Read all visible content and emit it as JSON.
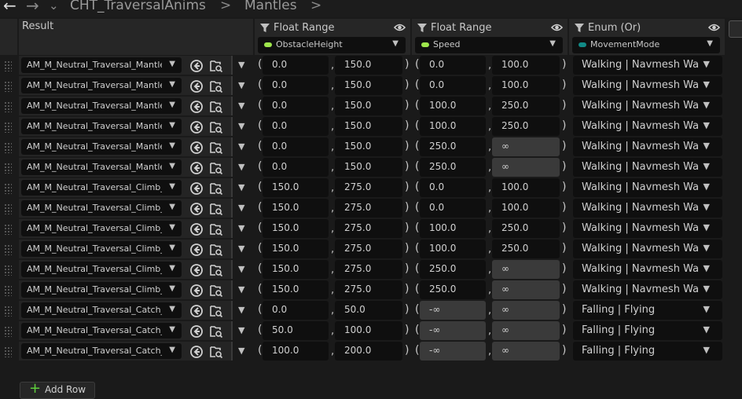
{
  "nav": {
    "back_icon": "arrow-left-icon",
    "forward_icon": "arrow-right-icon",
    "history_icon": "chevron-down-icon",
    "breadcrumb": [
      "CHT_TraversalAnims",
      "Mantles"
    ],
    "separator": ">"
  },
  "columns": {
    "result": {
      "title": "Result"
    },
    "filters": [
      {
        "title": "Float Range",
        "value": "ObstacleHeight",
        "pill_color": "#9ee64c"
      },
      {
        "title": "Float Range",
        "value": "Speed",
        "pill_color": "#9ee64c"
      },
      {
        "title": "Enum (Or)",
        "value": "MovementMode",
        "pill_color": "#118a86"
      }
    ]
  },
  "rows": [
    {
      "asset": "AM_M_Neutral_Traversal_Mantle_",
      "h_min": "0.0",
      "h_max": "150.0",
      "s_min": "0.0",
      "s_max": "100.0",
      "mode": "Walking | Navmesh Walking"
    },
    {
      "asset": "AM_M_Neutral_Traversal_Mantle_",
      "h_min": "0.0",
      "h_max": "150.0",
      "s_min": "0.0",
      "s_max": "100.0",
      "mode": "Walking | Navmesh Walking"
    },
    {
      "asset": "AM_M_Neutral_Traversal_Mantle_",
      "h_min": "0.0",
      "h_max": "150.0",
      "s_min": "100.0",
      "s_max": "250.0",
      "mode": "Walking | Navmesh Walking"
    },
    {
      "asset": "AM_M_Neutral_Traversal_Mantle_",
      "h_min": "0.0",
      "h_max": "150.0",
      "s_min": "100.0",
      "s_max": "250.0",
      "mode": "Walking | Navmesh Walking"
    },
    {
      "asset": "AM_M_Neutral_Traversal_Mantle_",
      "h_min": "0.0",
      "h_max": "150.0",
      "s_min": "250.0",
      "s_max": "∞",
      "mode": "Walking | Navmesh Walking"
    },
    {
      "asset": "AM_M_Neutral_Traversal_Mantle_",
      "h_min": "0.0",
      "h_max": "150.0",
      "s_min": "250.0",
      "s_max": "∞",
      "mode": "Walking | Navmesh Walking"
    },
    {
      "asset": "AM_M_Neutral_Traversal_Climb_S",
      "h_min": "150.0",
      "h_max": "275.0",
      "s_min": "0.0",
      "s_max": "100.0",
      "mode": "Walking | Navmesh Walking"
    },
    {
      "asset": "AM_M_Neutral_Traversal_Climb_S",
      "h_min": "150.0",
      "h_max": "275.0",
      "s_min": "0.0",
      "s_max": "100.0",
      "mode": "Walking | Navmesh Walking"
    },
    {
      "asset": "AM_M_Neutral_Traversal_Climb_S",
      "h_min": "150.0",
      "h_max": "275.0",
      "s_min": "100.0",
      "s_max": "250.0",
      "mode": "Walking | Navmesh Walking"
    },
    {
      "asset": "AM_M_Neutral_Traversal_Climb_S",
      "h_min": "150.0",
      "h_max": "275.0",
      "s_min": "100.0",
      "s_max": "250.0",
      "mode": "Walking | Navmesh Walking"
    },
    {
      "asset": "AM_M_Neutral_Traversal_Climb_S",
      "h_min": "150.0",
      "h_max": "275.0",
      "s_min": "250.0",
      "s_max": "∞",
      "mode": "Walking | Navmesh Walking"
    },
    {
      "asset": "AM_M_Neutral_Traversal_Climb_S",
      "h_min": "150.0",
      "h_max": "275.0",
      "s_min": "250.0",
      "s_max": "∞",
      "mode": "Walking | Navmesh Walking"
    },
    {
      "asset": "AM_M_Neutral_Traversal_Catch_M",
      "h_min": "0.0",
      "h_max": "50.0",
      "s_min": "-∞",
      "s_max": "∞",
      "mode": "Falling | Flying"
    },
    {
      "asset": "AM_M_Neutral_Traversal_Catch_M",
      "h_min": "50.0",
      "h_max": "100.0",
      "s_min": "-∞",
      "s_max": "∞",
      "mode": "Falling | Flying"
    },
    {
      "asset": "AM_M_Neutral_Traversal_Catch_C",
      "h_min": "100.0",
      "h_max": "200.0",
      "s_min": "-∞",
      "s_max": "∞",
      "mode": "Falling | Flying"
    }
  ],
  "row_icons": [
    "browse-asset-icon",
    "find-in-content-browser-icon",
    "expand-chevron-icon"
  ],
  "footer": {
    "add_row_label": "Add Row",
    "add_icon": "plus-icon"
  }
}
